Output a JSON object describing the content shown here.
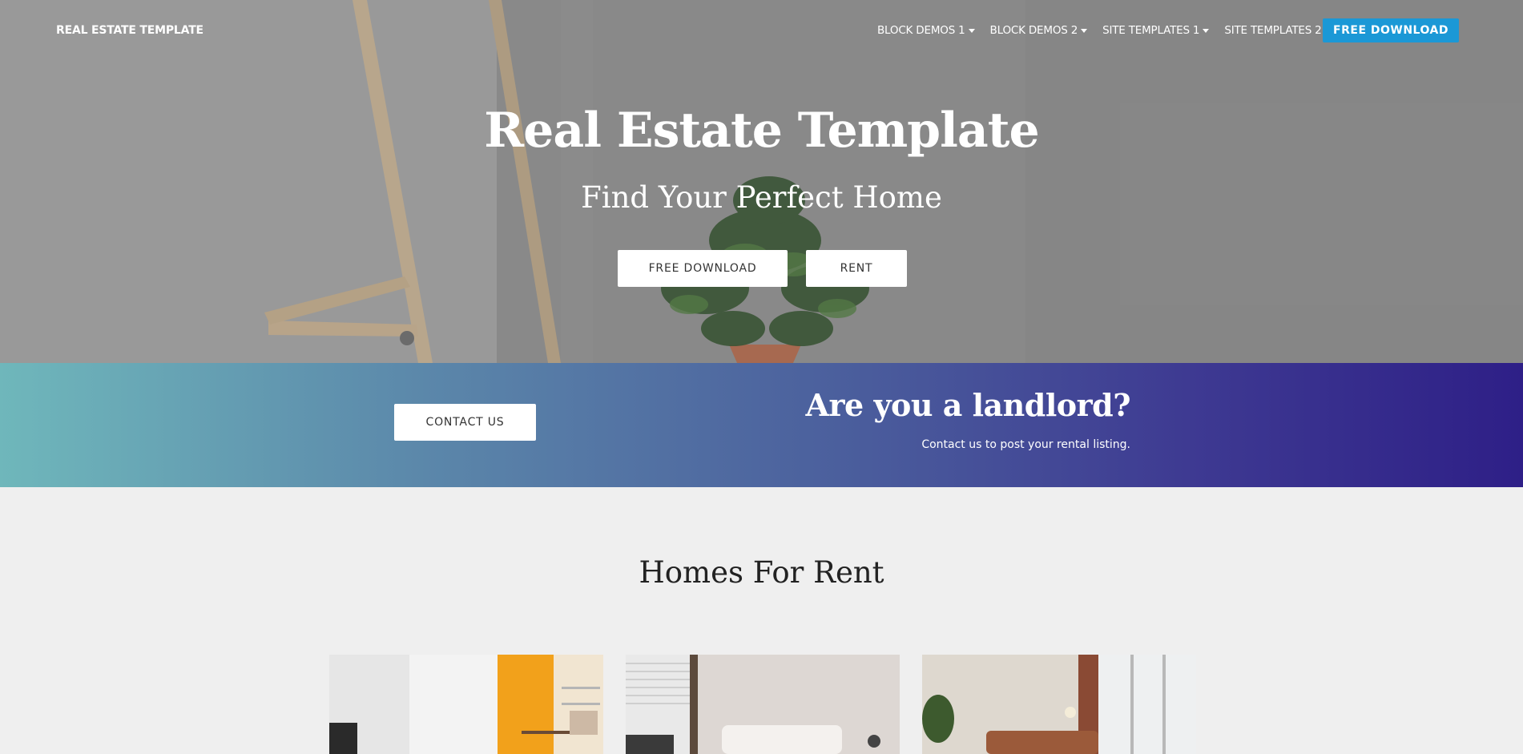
{
  "nav": {
    "brand": "REAL ESTATE TEMPLATE",
    "links": [
      {
        "label": "BLOCK DEMOS 1"
      },
      {
        "label": "BLOCK DEMOS 2"
      },
      {
        "label": "SITE TEMPLATES 1"
      },
      {
        "label": "SITE TEMPLATES 2"
      }
    ],
    "cta": "FREE DOWNLOAD"
  },
  "hero": {
    "title": "Real Estate Template",
    "subtitle": "Find Your Perfect Home",
    "buttons": [
      "FREE DOWNLOAD",
      "RENT"
    ]
  },
  "landlord": {
    "button": "CONTACT US",
    "title": "Are you a landlord?",
    "text": "Contact us to post your rental listing."
  },
  "homes": {
    "title": "Homes For Rent"
  },
  "colors": {
    "accent": "#1b98d6",
    "band_start": "#6fb7bb",
    "band_end": "#2e1f87",
    "page_bg": "#efefef"
  }
}
